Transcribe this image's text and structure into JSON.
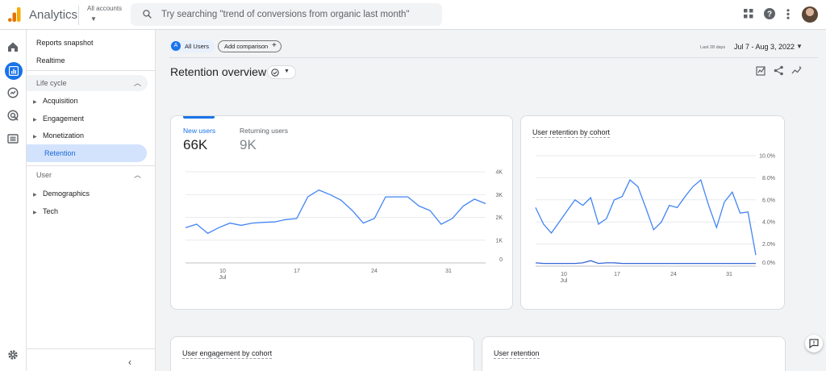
{
  "topbar": {
    "app_title": "Analytics",
    "account_label": "All accounts",
    "search_placeholder": "Try searching \"trend of conversions from organic last month\""
  },
  "nav": {
    "reports_snapshot": "Reports snapshot",
    "realtime": "Realtime",
    "lifecycle": {
      "title": "Life cycle",
      "items": [
        "Acquisition",
        "Engagement",
        "Monetization"
      ],
      "active": "Retention"
    },
    "user": {
      "title": "User",
      "items": [
        "Demographics",
        "Tech"
      ]
    }
  },
  "toolbar": {
    "segment_badge": "A",
    "segment": "All Users",
    "add_comparison": "Add comparison",
    "date_tag": "Last 28 days",
    "date_range": "Jul 7 - Aug 3, 2022"
  },
  "page": {
    "title": "Retention overview"
  },
  "cards": {
    "users": {
      "new_label": "New users",
      "new_value": "66K",
      "returning_label": "Returning users",
      "returning_value": "9K"
    },
    "cohort": {
      "title": "User retention by cohort"
    },
    "engagement_cohort": {
      "title": "User engagement by cohort"
    },
    "user_retention": {
      "title": "User retention"
    }
  },
  "colors": {
    "accent": "#1a73e8",
    "line": "#4285f4",
    "nav_active_bg": "#d3e3fd"
  },
  "chart_data": [
    {
      "type": "line",
      "title": "New users",
      "x": [
        "Jul 7",
        "Jul 8",
        "Jul 9",
        "Jul 10",
        "Jul 11",
        "Jul 12",
        "Jul 13",
        "Jul 14",
        "Jul 15",
        "Jul 16",
        "Jul 17",
        "Jul 18",
        "Jul 19",
        "Jul 20",
        "Jul 21",
        "Jul 22",
        "Jul 23",
        "Jul 24",
        "Jul 25",
        "Jul 26",
        "Jul 27",
        "Jul 28",
        "Jul 29",
        "Jul 30",
        "Jul 31",
        "Aug 1",
        "Aug 2",
        "Aug 3"
      ],
      "x_ticks": [
        {
          "label": "10",
          "sub": "Jul"
        },
        {
          "label": "17"
        },
        {
          "label": "24"
        },
        {
          "label": "31"
        }
      ],
      "y_ticks": [
        "4K",
        "3K",
        "2K",
        "1K",
        "0"
      ],
      "ylim": [
        0,
        4000
      ],
      "series": [
        {
          "values": [
            1550,
            1700,
            1300,
            1550,
            1750,
            1650,
            1750,
            1780,
            1800,
            1900,
            1950,
            2900,
            3200,
            3000,
            2750,
            2300,
            1750,
            1950,
            2900,
            2900,
            2900,
            2500,
            2300,
            1700,
            1950,
            2500,
            2800,
            2600
          ]
        }
      ]
    },
    {
      "type": "line",
      "title": "User retention by cohort",
      "x": [
        "Jul 7",
        "Jul 8",
        "Jul 9",
        "Jul 10",
        "Jul 11",
        "Jul 12",
        "Jul 13",
        "Jul 14",
        "Jul 15",
        "Jul 16",
        "Jul 17",
        "Jul 18",
        "Jul 19",
        "Jul 20",
        "Jul 21",
        "Jul 22",
        "Jul 23",
        "Jul 24",
        "Jul 25",
        "Jul 26",
        "Jul 27",
        "Jul 28",
        "Jul 29",
        "Jul 30",
        "Jul 31",
        "Aug 1",
        "Aug 2"
      ],
      "x_ticks": [
        {
          "label": "10",
          "sub": "Jul"
        },
        {
          "label": "17"
        },
        {
          "label": "24"
        },
        {
          "label": "31"
        }
      ],
      "y_ticks": [
        "10.0%",
        "8.0%",
        "6.0%",
        "4.0%",
        "2.0%",
        "0.0%"
      ],
      "ylim": [
        0,
        10
      ],
      "series": [
        {
          "values": [
            5.3,
            3.8,
            3.0,
            4.0,
            5.0,
            6.0,
            5.5,
            6.2,
            3.8,
            4.3,
            6.0,
            6.3,
            7.8,
            7.2,
            5.3,
            3.3,
            4.0,
            5.5,
            5.3,
            6.3,
            7.2,
            7.8,
            5.5,
            3.5,
            5.8,
            6.7,
            4.8,
            4.9,
            1.0
          ]
        },
        {
          "values": [
            0.3,
            0.25,
            0.25,
            0.25,
            0.25,
            0.25,
            0.3,
            0.5,
            0.25,
            0.3,
            0.3,
            0.25,
            0.25,
            0.25,
            0.25,
            0.25,
            0.25,
            0.25,
            0.25,
            0.25,
            0.25,
            0.25,
            0.25,
            0.25,
            0.25,
            0.25,
            0.25,
            0.25,
            0.25
          ]
        }
      ]
    }
  ]
}
